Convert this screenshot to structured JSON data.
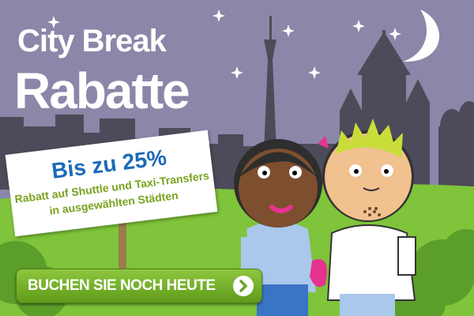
{
  "banner": {
    "headline_line1": "City Break",
    "headline_line2": "Rabatte",
    "offer_title": "Bis zu 25%",
    "offer_line1": "Rabatt auf Shuttle und Taxi-Transfers",
    "offer_line2": "in ausgewählten Städten",
    "cta_label": "BUCHEN SIE NOCH HEUTE",
    "cta_icon": "chevron-right-icon"
  },
  "colors": {
    "sky": "#8a87a9",
    "ground": "#7fc43a",
    "skyline": "#4d4b59",
    "offer_title": "#1c6ab5",
    "offer_text": "#7aa21e",
    "cta_green": "#7ab72e"
  }
}
